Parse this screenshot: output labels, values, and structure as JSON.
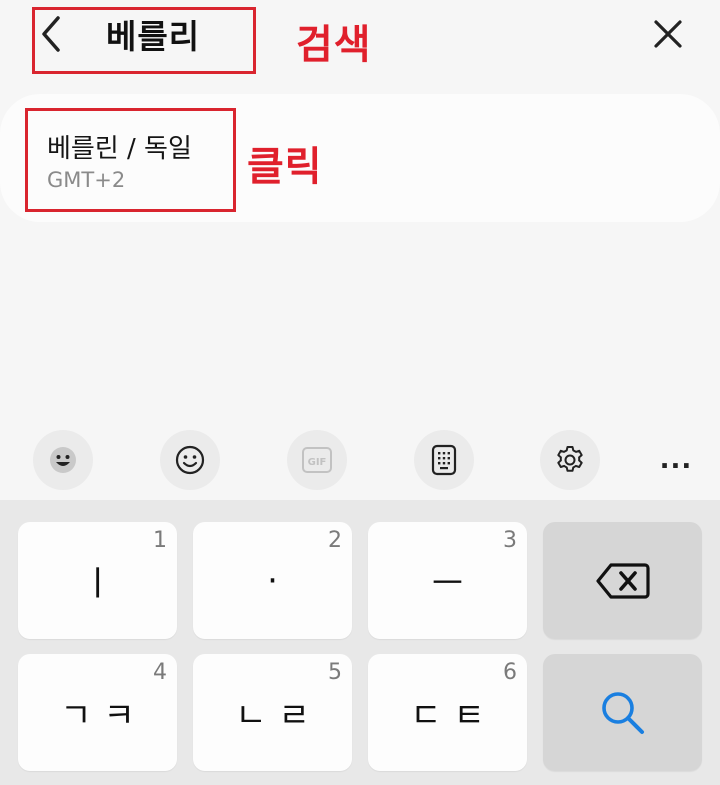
{
  "header": {
    "back_icon": "chevron-left-icon",
    "search_value": "베를리",
    "close_icon": "close-icon"
  },
  "annotations": {
    "label_search": "검색",
    "label_click": "클릭",
    "highlight_color": "#e0202c"
  },
  "result": {
    "city": "베를린 / 독일",
    "timezone": "GMT+2"
  },
  "toolbar": {
    "items": [
      "emoji-mode-icon",
      "emoji-icon",
      "gif-icon",
      "keypad-icon",
      "settings-icon",
      "more-icon"
    ],
    "gif_label": "GIF",
    "more_label": "..."
  },
  "keyboard": {
    "keys": [
      {
        "num": "1",
        "glyph": "ㅣ"
      },
      {
        "num": "2",
        "glyph": "·"
      },
      {
        "num": "3",
        "glyph": "ㅡ"
      },
      {
        "glyph_icon": "backspace-icon"
      },
      {
        "num": "4",
        "glyph": "ㄱㅋ"
      },
      {
        "num": "5",
        "glyph": "ㄴㄹ"
      },
      {
        "num": "6",
        "glyph": "ㄷㅌ"
      },
      {
        "glyph_icon": "search-icon"
      }
    ],
    "accent_color": "#1a7fe0"
  }
}
